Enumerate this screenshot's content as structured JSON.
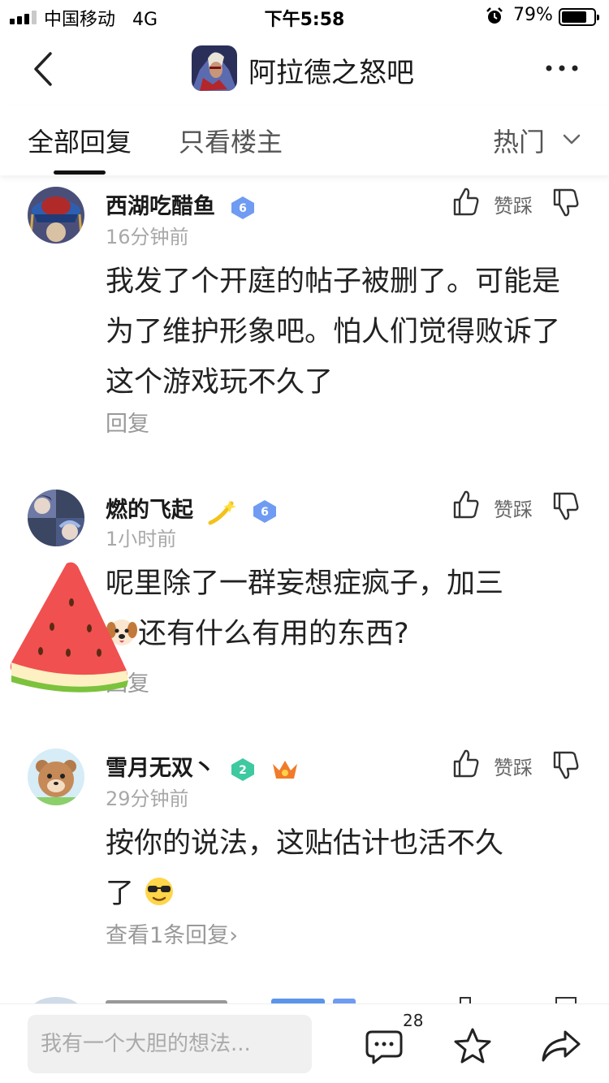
{
  "status_bar": {
    "carrier": "中国移动",
    "network": "4G",
    "time": "下午5:58",
    "battery_percent": "79%",
    "battery_level": 0.79
  },
  "header": {
    "title": "阿拉德之怒吧"
  },
  "tabs": {
    "all_replies": "全部回复",
    "owner_only": "只看楼主",
    "sort_label": "热门"
  },
  "comments": [
    {
      "username": "西湖吃醋鱼",
      "level_badge": "6",
      "time": "16分钟前",
      "vote_label": "赞踩",
      "text": "我发了个开庭的帖子被删了。可能是为了维护形象吧。怕人们觉得败诉了这个游戏玩不久了",
      "reply_label": "回复"
    },
    {
      "username": "燃的飞起",
      "level_badge": "6",
      "time": "1小时前",
      "vote_label": "赞踩",
      "text_line1": "呢里除了一群妄想症疯子，加三",
      "text_line2": "还有什么有用的东西?",
      "reply_label": "回复"
    },
    {
      "username": "雪月无双丶",
      "level_badge": "2",
      "time": "29分钟前",
      "vote_label": "赞踩",
      "text_line1": "按你的说法，这贴估计也活不久",
      "text_line2": "了",
      "reply_label": "查看1条回复",
      "reply_chevron": "›"
    }
  ],
  "bottom_bar": {
    "input_placeholder": "我有一个大胆的想法...",
    "comment_count": "28"
  },
  "colors": {
    "badge_blue": "#6f9cf2",
    "badge_green": "#3ec9a0",
    "time_gray": "#a8a8a8",
    "input_bg": "#f0f0f0"
  },
  "icons": [
    "back-icon",
    "more-icon",
    "chevron-down-icon",
    "thumbs-up-icon",
    "thumbs-down-icon",
    "comment-icon",
    "star-icon",
    "share-icon",
    "alarm-icon",
    "battery-icon",
    "signal-icon"
  ]
}
